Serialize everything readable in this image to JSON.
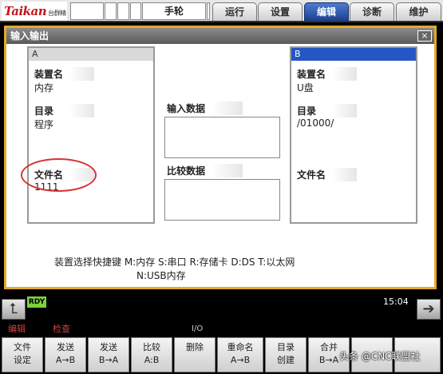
{
  "header": {
    "logo_text": "Taikan",
    "logo_sub": "台群精机",
    "mode": "手轮",
    "tabs": [
      {
        "label": "运行",
        "active": false
      },
      {
        "label": "设置",
        "active": false
      },
      {
        "label": "编辑",
        "active": true
      },
      {
        "label": "诊断",
        "active": false
      },
      {
        "label": "维护",
        "active": false
      }
    ]
  },
  "window": {
    "title": "输入输出",
    "close": "×"
  },
  "panel_a": {
    "header": "A",
    "device_label": "装置名",
    "device_value": "内存",
    "dir_label": "目录",
    "dir_value": "程序",
    "file_label": "文件名",
    "file_value": "1111"
  },
  "middle": {
    "input_label": "输入数据",
    "compare_label": "比较数据"
  },
  "panel_b": {
    "header": "B",
    "device_label": "装置名",
    "device_value": "U盘",
    "dir_label": "目录",
    "dir_value": "/01000/",
    "file_label": "文件名"
  },
  "hint": {
    "line1": "装置选择快捷键 M:内存 S:串口 R:存储卡 D:DS T:以太网",
    "line2": "N:USB内存"
  },
  "status": {
    "ready": "RDY",
    "time": "15:04"
  },
  "modes": {
    "edit": "编辑",
    "check": "检查",
    "io": "I/O"
  },
  "softkeys": [
    {
      "l1": "文件",
      "l2": "设定"
    },
    {
      "l1": "发送",
      "l2": "A→B"
    },
    {
      "l1": "发送",
      "l2": "B→A"
    },
    {
      "l1": "比较",
      "l2": "A:B"
    },
    {
      "l1": "删除",
      "l2": ""
    },
    {
      "l1": "重命名",
      "l2": "A→B"
    },
    {
      "l1": "目录",
      "l2": "创建"
    },
    {
      "l1": "合并",
      "l2": "B→A"
    }
  ],
  "watermark": "头条 @CNC联盟社"
}
